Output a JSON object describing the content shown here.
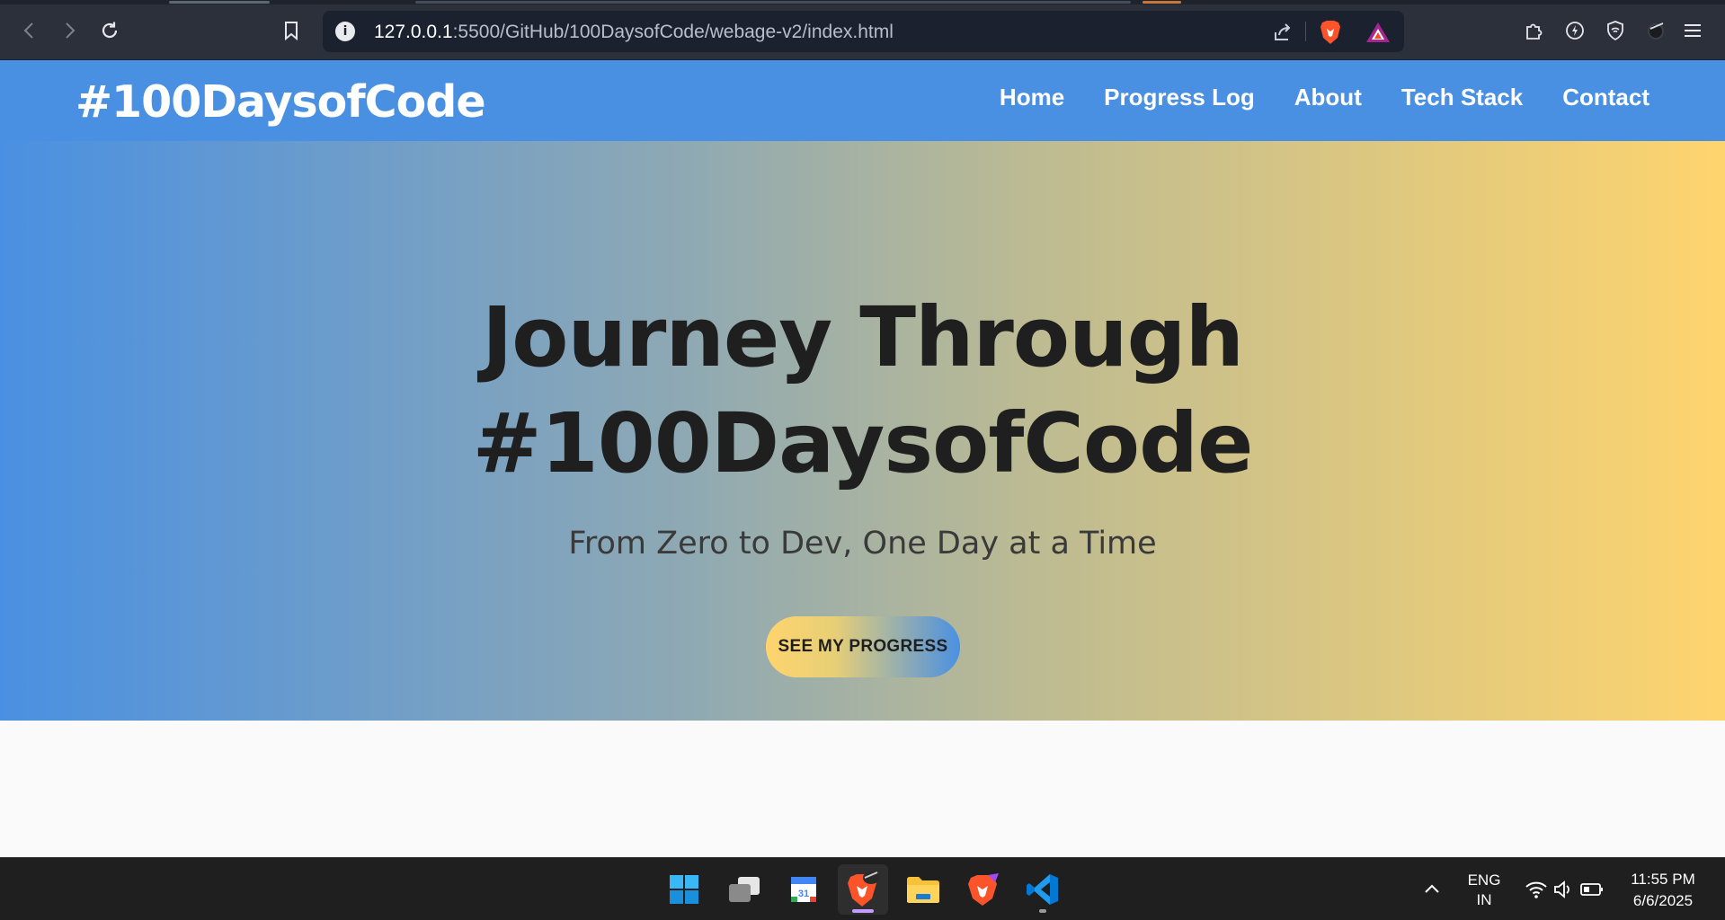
{
  "browser": {
    "url_host": "127.0.0.1",
    "url_path": ":5500/GitHub/100DaysofCode/webage-v2/index.html",
    "info_icon": "i"
  },
  "site": {
    "brand": "#100DaysofCode",
    "nav": [
      "Home",
      "Progress Log",
      "About",
      "Tech Stack",
      "Contact"
    ],
    "hero_title_line1": "Journey Through",
    "hero_title_line2": "#100DaysofCode",
    "hero_subtitle": "From Zero to Dev, One Day at a Time",
    "cta_label": "SEE MY PROGRESS",
    "colors": {
      "primary": "#4a90e2",
      "accent": "#fed46e",
      "text": "#1f1f1f"
    }
  },
  "taskbar": {
    "apps": [
      "windows-start",
      "task-view",
      "calendar",
      "brave-browser",
      "file-explorer",
      "brave-nightly",
      "vs-code"
    ],
    "calendar_day": "31",
    "lang_line1": "ENG",
    "lang_line2": "IN",
    "time": "11:55 PM",
    "date": "6/6/2025"
  }
}
